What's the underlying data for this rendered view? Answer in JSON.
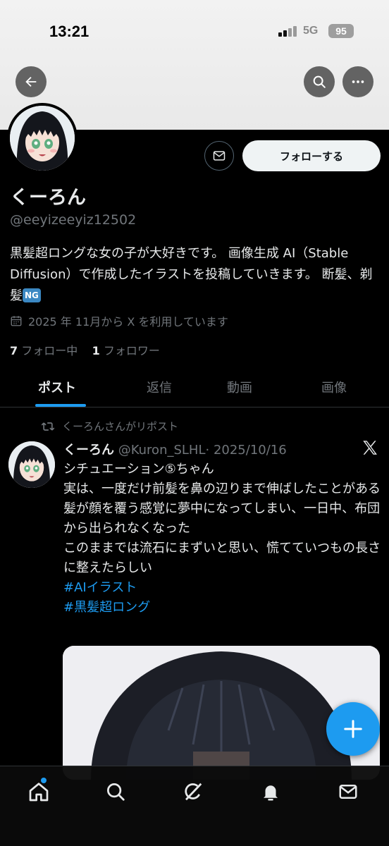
{
  "status_bar": {
    "time": "13:21",
    "network": "5G",
    "battery": "95"
  },
  "header": {
    "back_icon": "arrow-left-icon",
    "search_icon": "search-icon",
    "more_icon": "more-icon"
  },
  "profile": {
    "name": "くーろん",
    "handle": "@eeyizeeyiz12502",
    "bio_text": "黒髪超ロングな女の子が大好きです。 画像生成 AI（Stable Diffusion）で作成したイラストを投稿していきます。 断髪、剃髪",
    "bio_emoji": "NG",
    "joined": "2025 年 11月から X を利用しています",
    "following_count": "7",
    "following_label": "フォロー中",
    "followers_count": "1",
    "followers_label": "フォロワー",
    "follow_button": "フォローする"
  },
  "tabs": [
    {
      "label": "ポスト",
      "active": true
    },
    {
      "label": "返信",
      "active": false
    },
    {
      "label": "動画",
      "active": false
    },
    {
      "label": "画像",
      "active": false
    }
  ],
  "post": {
    "repost_label": "くーろんさんがリポスト",
    "author_name": "くーろん",
    "author_handle": "@Kuron_SLHL",
    "date": "· 2025/10/16",
    "lines": [
      "シチュエーション⑤ちゃん",
      "実は、一度だけ前髪を鼻の辺りまで伸ばしたことがある",
      "髪が顔を覆う感覚に夢中になってしまい、一日中、布団から出られなくなった",
      "このままでは流石にまずいと思い、慌てていつもの長さに整えたらしい"
    ],
    "hashtags": [
      "#AIイラスト",
      "#黒髪超ロング"
    ]
  },
  "colors": {
    "accent": "#1d9bf0",
    "background": "#000000",
    "muted": "#71767b"
  },
  "bottom_nav": [
    "home-icon",
    "search-icon",
    "grok-icon",
    "notifications-icon",
    "messages-icon"
  ]
}
